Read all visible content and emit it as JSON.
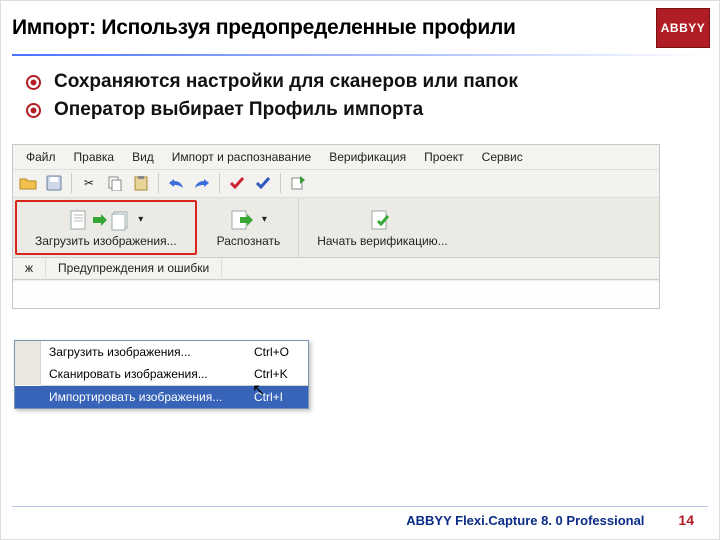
{
  "slide": {
    "title": "Импорт: Используя предопределенные профили",
    "logo_text": "ABBYY",
    "bullets": [
      "Сохраняются настройки для сканеров или папок",
      "Оператор выбирает Профиль импорта"
    ]
  },
  "app": {
    "menu": [
      "Файл",
      "Правка",
      "Вид",
      "Импорт и распознавание",
      "Верификация",
      "Проект",
      "Сервис"
    ],
    "bigButtons": {
      "load": "Загрузить изображения...",
      "recognize": "Распознать",
      "verify": "Начать верификацию..."
    },
    "tabs": [
      "ж",
      "Предупреждения и ошибки"
    ],
    "dropdown": {
      "item1": {
        "label": "Загрузить изображения...",
        "shortcut": "Ctrl+O"
      },
      "item2": {
        "label": "Сканировать изображения...",
        "shortcut": "Ctrl+K"
      },
      "item3": {
        "label": "Импортировать изображения...",
        "shortcut": "Ctrl+I"
      }
    }
  },
  "footer": {
    "product": "ABBYY Flexi.Capture 8. 0 Professional",
    "page": "14"
  }
}
